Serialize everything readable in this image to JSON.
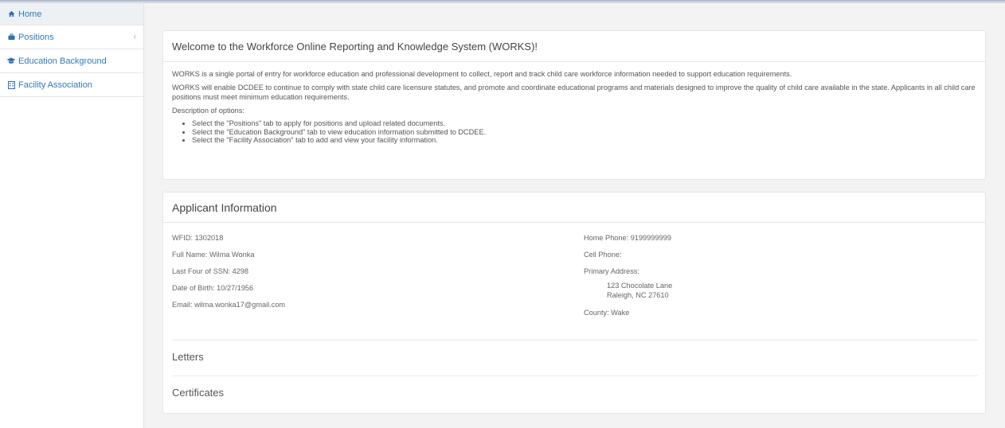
{
  "sidebar": {
    "items": [
      {
        "label": "Home",
        "icon": "home-icon"
      },
      {
        "label": "Positions",
        "icon": "briefcase-icon"
      },
      {
        "label": "Education Background",
        "icon": "graduation-cap-icon"
      },
      {
        "label": "Facility Association",
        "icon": "building-icon"
      }
    ]
  },
  "welcome": {
    "title": "Welcome to the Workforce Online Reporting and Knowledge System (WORKS)!",
    "para1": "WORKS is a single portal of entry for workforce education and professional development to collect, report and track child care workforce information needed to support education requirements.",
    "para2": "WORKS will enable DCDEE to continue to comply with state child care licensure statutes, and promote and coordinate educational programs and materials designed to improve the quality of child care available in the state. Applicants in all child care positions must meet minimum education requirements.",
    "desc_label": "Description of options:",
    "options": [
      "Select the \"Positions\" tab to apply for positions and upload related documents.",
      "Select the \"Education Background\" tab to view education information submitted to DCDEE.",
      "Select the \"Facility Association\" tab to add and view your facility information."
    ]
  },
  "applicant": {
    "title": "Applicant Information",
    "wfid": "WFID: 1302018",
    "full_name": "Full Name: Wilma Wonka",
    "ssn": "Last Four of SSN: 4298",
    "dob": "Date of Birth: 10/27/1956",
    "email": "Email: wilma.wonka17@gmail.com",
    "home_phone": "Home Phone: 9199999999",
    "cell_phone": "Cell Phone:",
    "primary_address_label": "Primary Address:",
    "address_line1": "123 Chocolate Lane",
    "address_line2": "Raleigh, NC 27610",
    "county": "County: Wake",
    "letters": "Letters",
    "certificates": "Certificates"
  },
  "colors": {
    "link": "#337ab7",
    "background": "#f3f3f4"
  }
}
